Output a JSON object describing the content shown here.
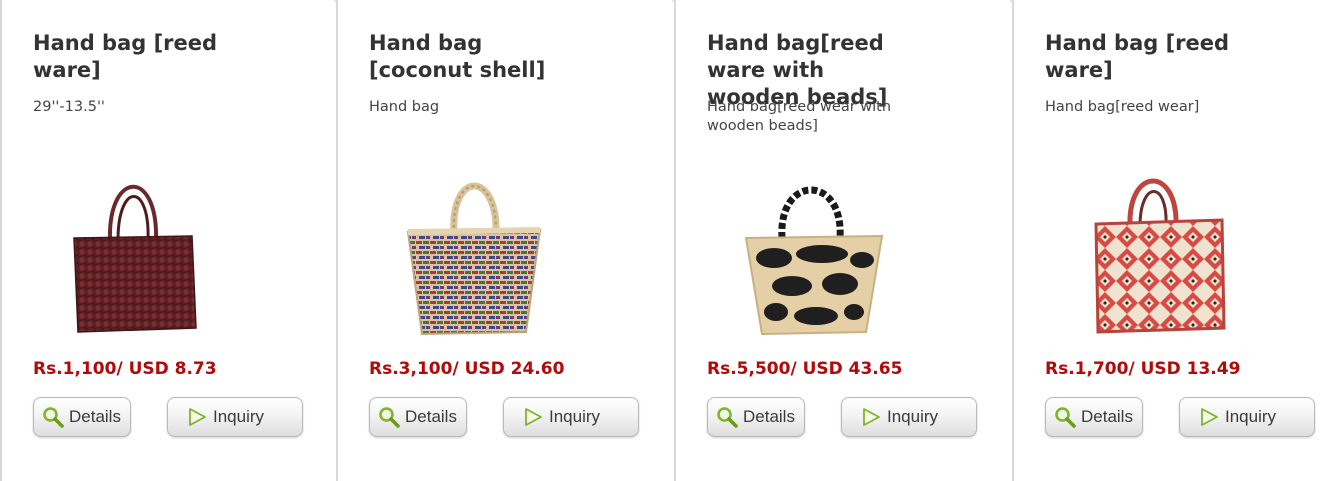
{
  "products": [
    {
      "title": "Hand bag [reed ware]",
      "description": "29''-13.5''",
      "price": "Rs.1,100/ USD 8.73",
      "image": "maroon-reed-handbag",
      "details_label": "Details",
      "inquiry_label": "Inquiry"
    },
    {
      "title": "Hand bag [coconut shell]",
      "description": "Hand bag",
      "price": "Rs.3,100/ USD 24.60",
      "image": "multicolor-woven-tote",
      "details_label": "Details",
      "inquiry_label": "Inquiry"
    },
    {
      "title": "Hand bag[reed ware with wooden beads]",
      "description": "Hand bag[reed wear with wooden beads]",
      "price": "Rs.5,500/ USD 43.65",
      "image": "beige-black-beaded-bag",
      "details_label": "Details",
      "inquiry_label": "Inquiry"
    },
    {
      "title": "Hand bag [reed ware]",
      "description": "Hand bag[reed wear]",
      "price": "Rs.1,700/ USD 13.49",
      "image": "red-cream-pattern-bag",
      "details_label": "Details",
      "inquiry_label": "Inquiry"
    }
  ],
  "icons": {
    "details": "magnifier-icon",
    "inquiry": "play-arrow-icon"
  },
  "colors": {
    "price": "#b20a0a",
    "title": "#333333",
    "icon_green": "#7fb52a"
  }
}
